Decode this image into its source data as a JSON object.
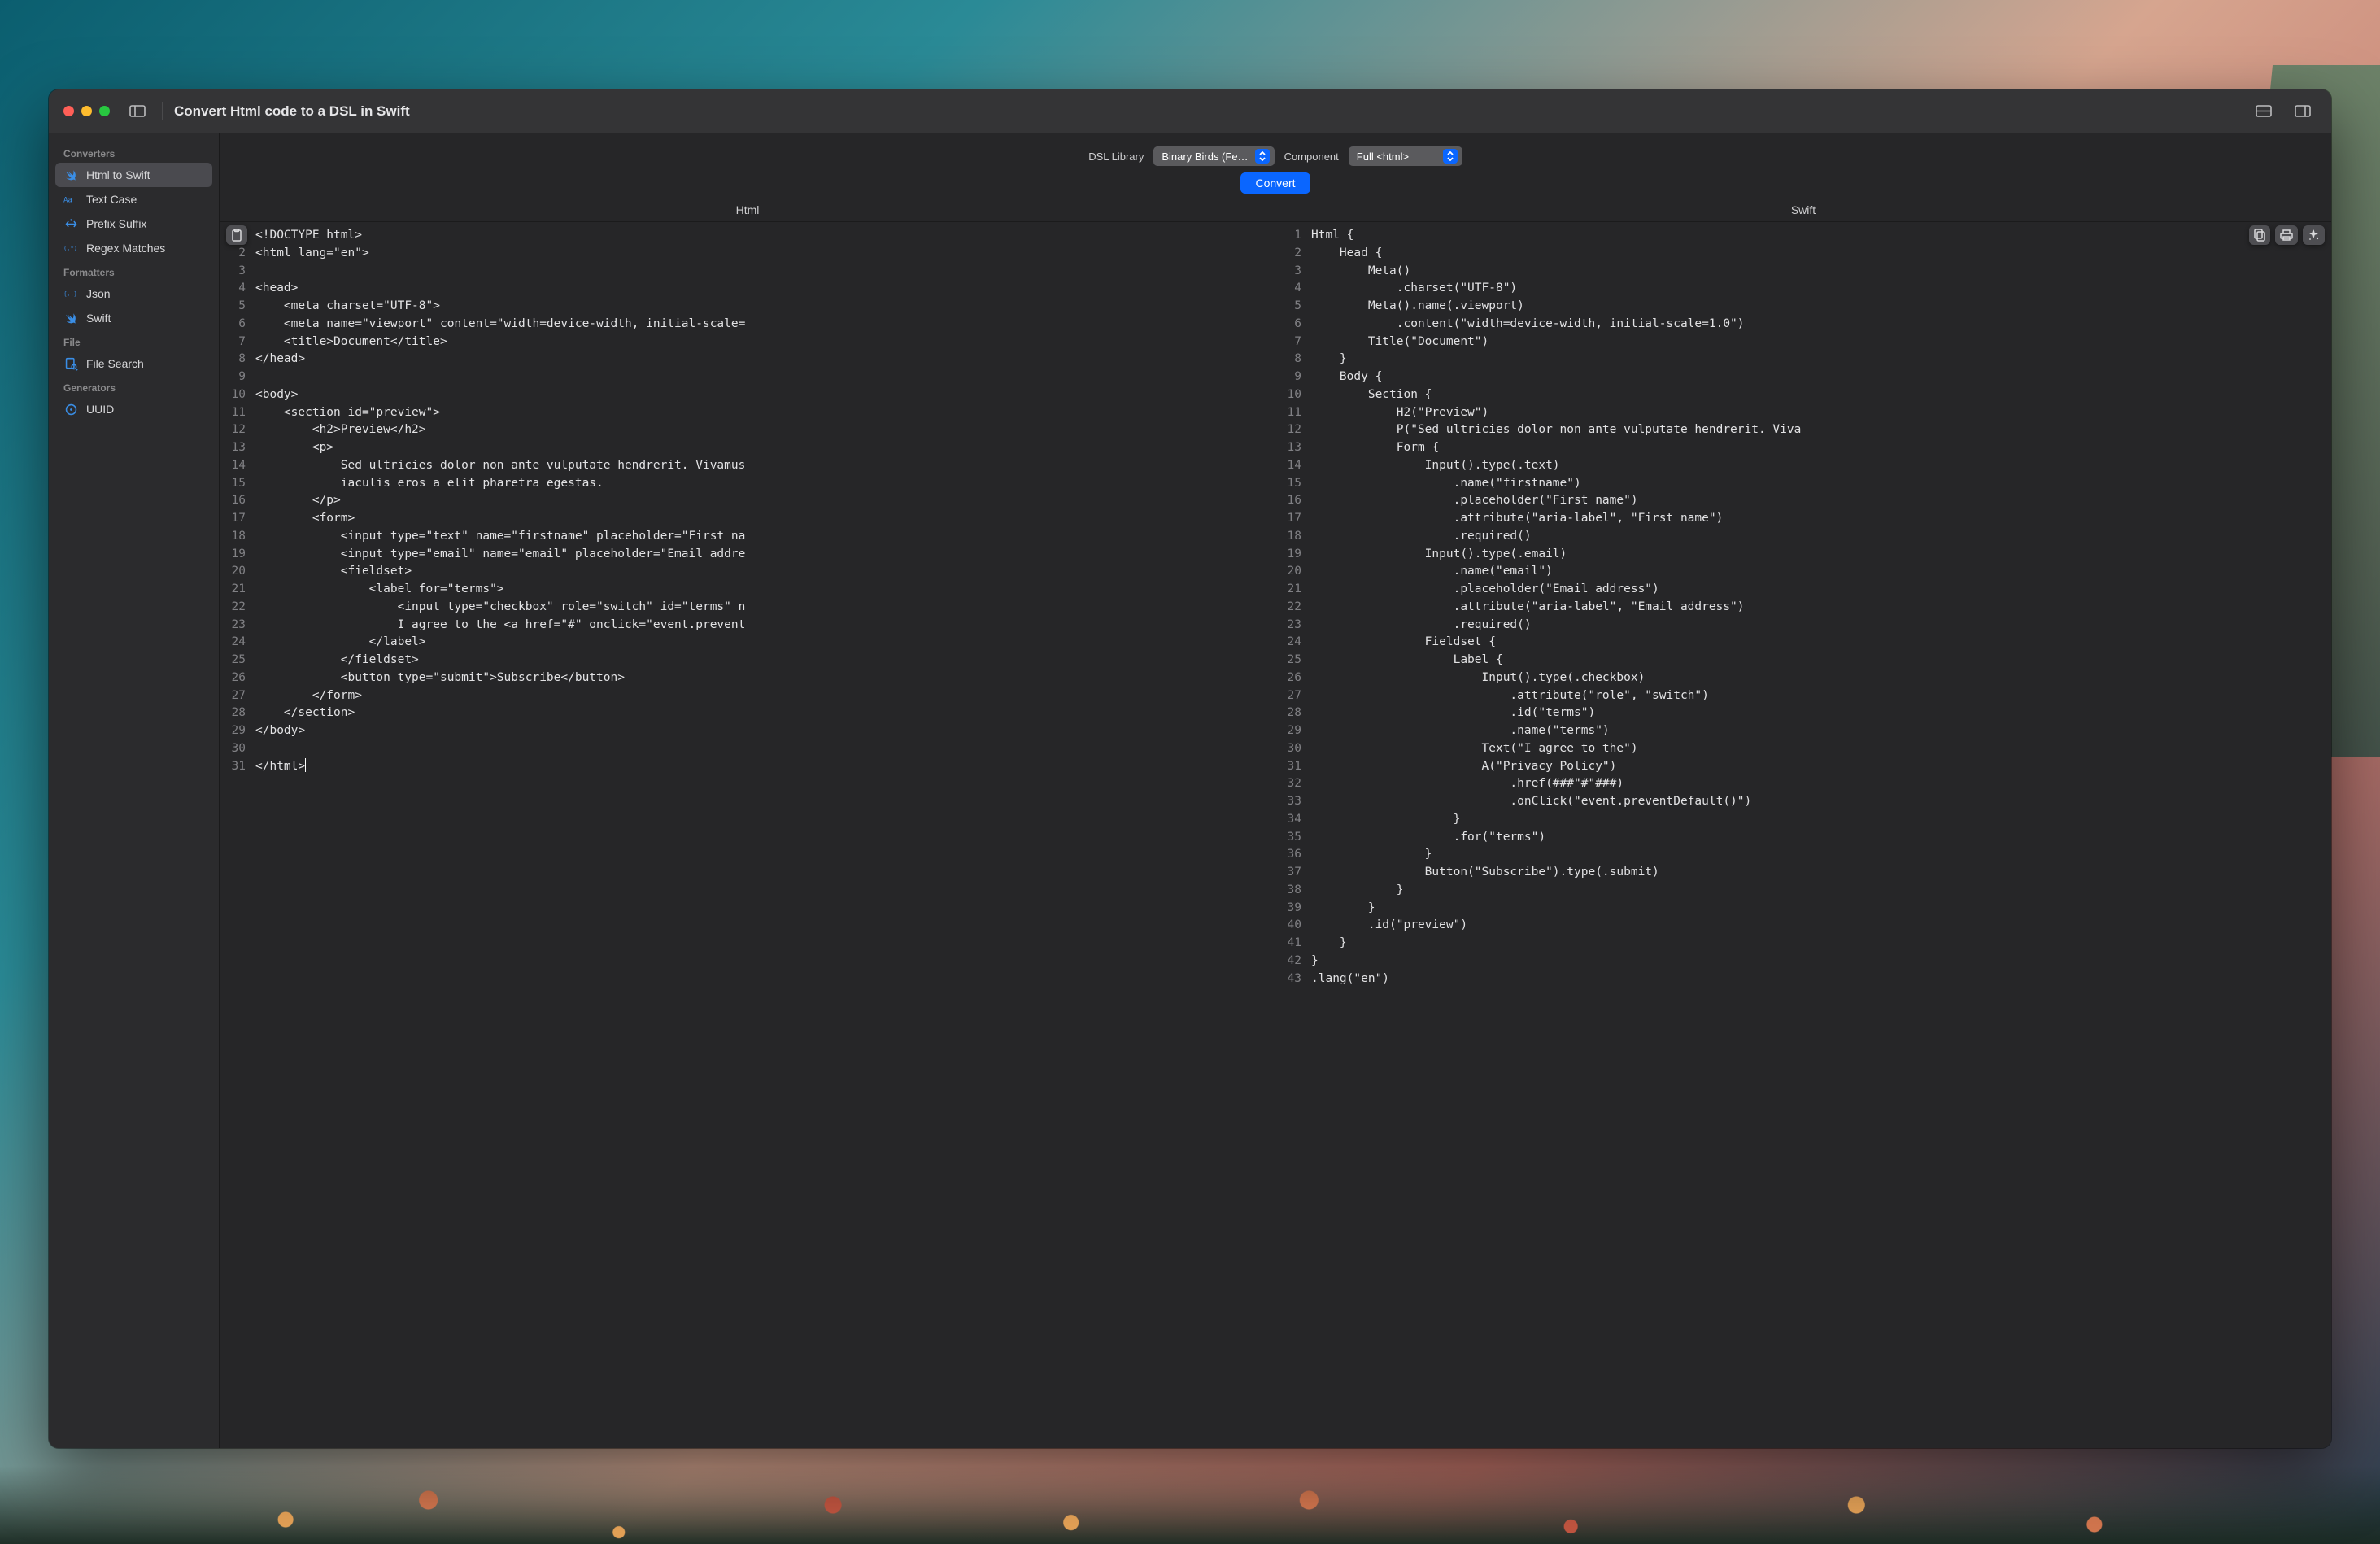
{
  "title": "Convert Html code to a DSL in Swift",
  "sidebar": {
    "groups": [
      {
        "header": "Converters",
        "items": [
          {
            "name": "html-to-swift",
            "label": "Html to Swift",
            "selected": true,
            "icon": "swift"
          },
          {
            "name": "text-case",
            "label": "Text Case",
            "icon": "aa"
          },
          {
            "name": "prefix-suffix",
            "label": "Prefix Suffix",
            "icon": "presuf"
          },
          {
            "name": "regex-matches",
            "label": "Regex Matches",
            "icon": "regex"
          }
        ]
      },
      {
        "header": "Formatters",
        "items": [
          {
            "name": "json",
            "label": "Json",
            "icon": "braces"
          },
          {
            "name": "swift-fmt",
            "label": "Swift",
            "icon": "swift"
          }
        ]
      },
      {
        "header": "File",
        "items": [
          {
            "name": "file-search",
            "label": "File Search",
            "icon": "filesearch"
          }
        ]
      },
      {
        "header": "Generators",
        "items": [
          {
            "name": "uuid",
            "label": "UUID",
            "icon": "target"
          }
        ]
      }
    ]
  },
  "controls": {
    "dsl_label": "DSL Library",
    "dsl_value": "Binary Birds (Fe…",
    "component_label": "Component",
    "component_value": "Full <html>",
    "convert_label": "Convert"
  },
  "panes": {
    "left_header": "Html",
    "right_header": "Swift"
  },
  "code": {
    "html_lines": [
      "<!DOCTYPE html>",
      "<html lang=\"en\">",
      "",
      "<head>",
      "    <meta charset=\"UTF-8\">",
      "    <meta name=\"viewport\" content=\"width=device-width, initial-scale=",
      "    <title>Document</title>",
      "</head>",
      "",
      "<body>",
      "    <section id=\"preview\">",
      "        <h2>Preview</h2>",
      "        <p>",
      "            Sed ultricies dolor non ante vulputate hendrerit. Vivamus",
      "            iaculis eros a elit pharetra egestas.",
      "        </p>",
      "        <form>",
      "            <input type=\"text\" name=\"firstname\" placeholder=\"First na",
      "            <input type=\"email\" name=\"email\" placeholder=\"Email addre",
      "            <fieldset>",
      "                <label for=\"terms\">",
      "                    <input type=\"checkbox\" role=\"switch\" id=\"terms\" n",
      "                    I agree to the <a href=\"#\" onclick=\"event.prevent",
      "                </label>",
      "            </fieldset>",
      "            <button type=\"submit\">Subscribe</button>",
      "        </form>",
      "    </section>",
      "</body>",
      "",
      "</html>"
    ],
    "swift_lines": [
      "Html {",
      "    Head {",
      "        Meta()",
      "            .charset(\"UTF-8\")",
      "        Meta().name(.viewport)",
      "            .content(\"width=device-width, initial-scale=1.0\")",
      "        Title(\"Document\")",
      "    }",
      "    Body {",
      "        Section {",
      "            H2(\"Preview\")",
      "            P(\"Sed ultricies dolor non ante vulputate hendrerit. Viva",
      "            Form {",
      "                Input().type(.text)",
      "                    .name(\"firstname\")",
      "                    .placeholder(\"First name\")",
      "                    .attribute(\"aria-label\", \"First name\")",
      "                    .required()",
      "                Input().type(.email)",
      "                    .name(\"email\")",
      "                    .placeholder(\"Email address\")",
      "                    .attribute(\"aria-label\", \"Email address\")",
      "                    .required()",
      "                Fieldset {",
      "                    Label {",
      "                        Input().type(.checkbox)",
      "                            .attribute(\"role\", \"switch\")",
      "                            .id(\"terms\")",
      "                            .name(\"terms\")",
      "                        Text(\"I agree to the\")",
      "                        A(\"Privacy Policy\")",
      "                            .href(###\"#\"###)",
      "                            .onClick(\"event.preventDefault()\")",
      "                    }",
      "                    .for(\"terms\")",
      "                }",
      "                Button(\"Subscribe\").type(.submit)",
      "            }",
      "        }",
      "        .id(\"preview\")",
      "    }",
      "}",
      ".lang(\"en\")"
    ]
  }
}
